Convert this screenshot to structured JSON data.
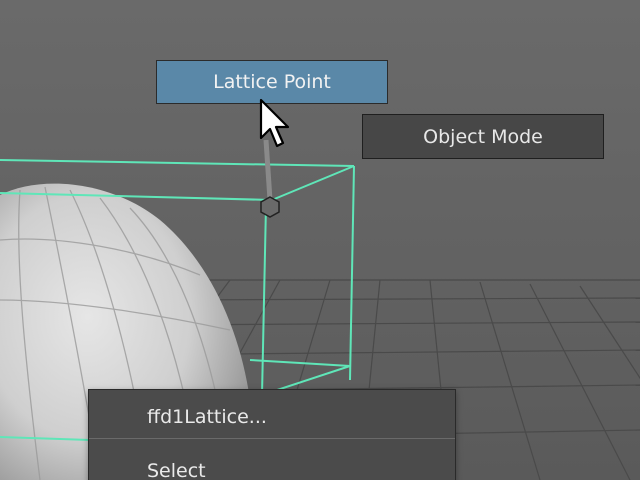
{
  "marking_menu": {
    "north": "Lattice Point",
    "northeast": "Object Mode"
  },
  "context_menu": {
    "items": [
      "ffd1Lattice...",
      "Select"
    ]
  },
  "colors": {
    "viewport_bg": "#636363",
    "lattice_wire": "#5fe6b8",
    "highlight_button": "#5a88a8",
    "menu_bg": "#4b4b4b"
  }
}
